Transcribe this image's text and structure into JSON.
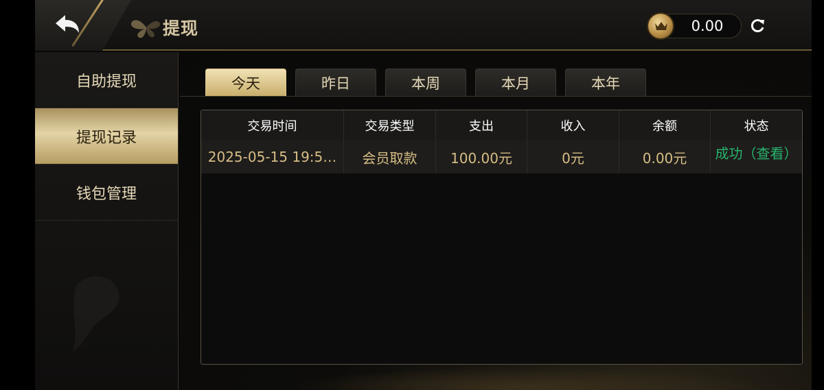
{
  "header": {
    "title": "提现",
    "balance": "0.00"
  },
  "sidebar": {
    "items": [
      {
        "label": "自助提现"
      },
      {
        "label": "提现记录"
      },
      {
        "label": "钱包管理"
      }
    ],
    "active_index": 1
  },
  "tabs": {
    "items": [
      {
        "label": "今天"
      },
      {
        "label": "昨日"
      },
      {
        "label": "本周"
      },
      {
        "label": "本月"
      },
      {
        "label": "本年"
      }
    ],
    "active_index": 0
  },
  "table": {
    "headers": [
      "交易时间",
      "交易类型",
      "支出",
      "收入",
      "余额",
      "状态"
    ],
    "rows": [
      {
        "time": "2025-05-15 19:5…",
        "type": "会员取款",
        "expense": "100.00元",
        "income": "0元",
        "balance": "0.00元",
        "status": "成功（查看）"
      }
    ]
  },
  "colors": {
    "gold": "#d7bd85",
    "status_success": "#27b36c",
    "accent_gold_light": "#e3d4a6"
  },
  "icons": {
    "back": "back-arrow-icon",
    "coin": "crown-coin-icon",
    "refresh": "refresh-icon"
  }
}
